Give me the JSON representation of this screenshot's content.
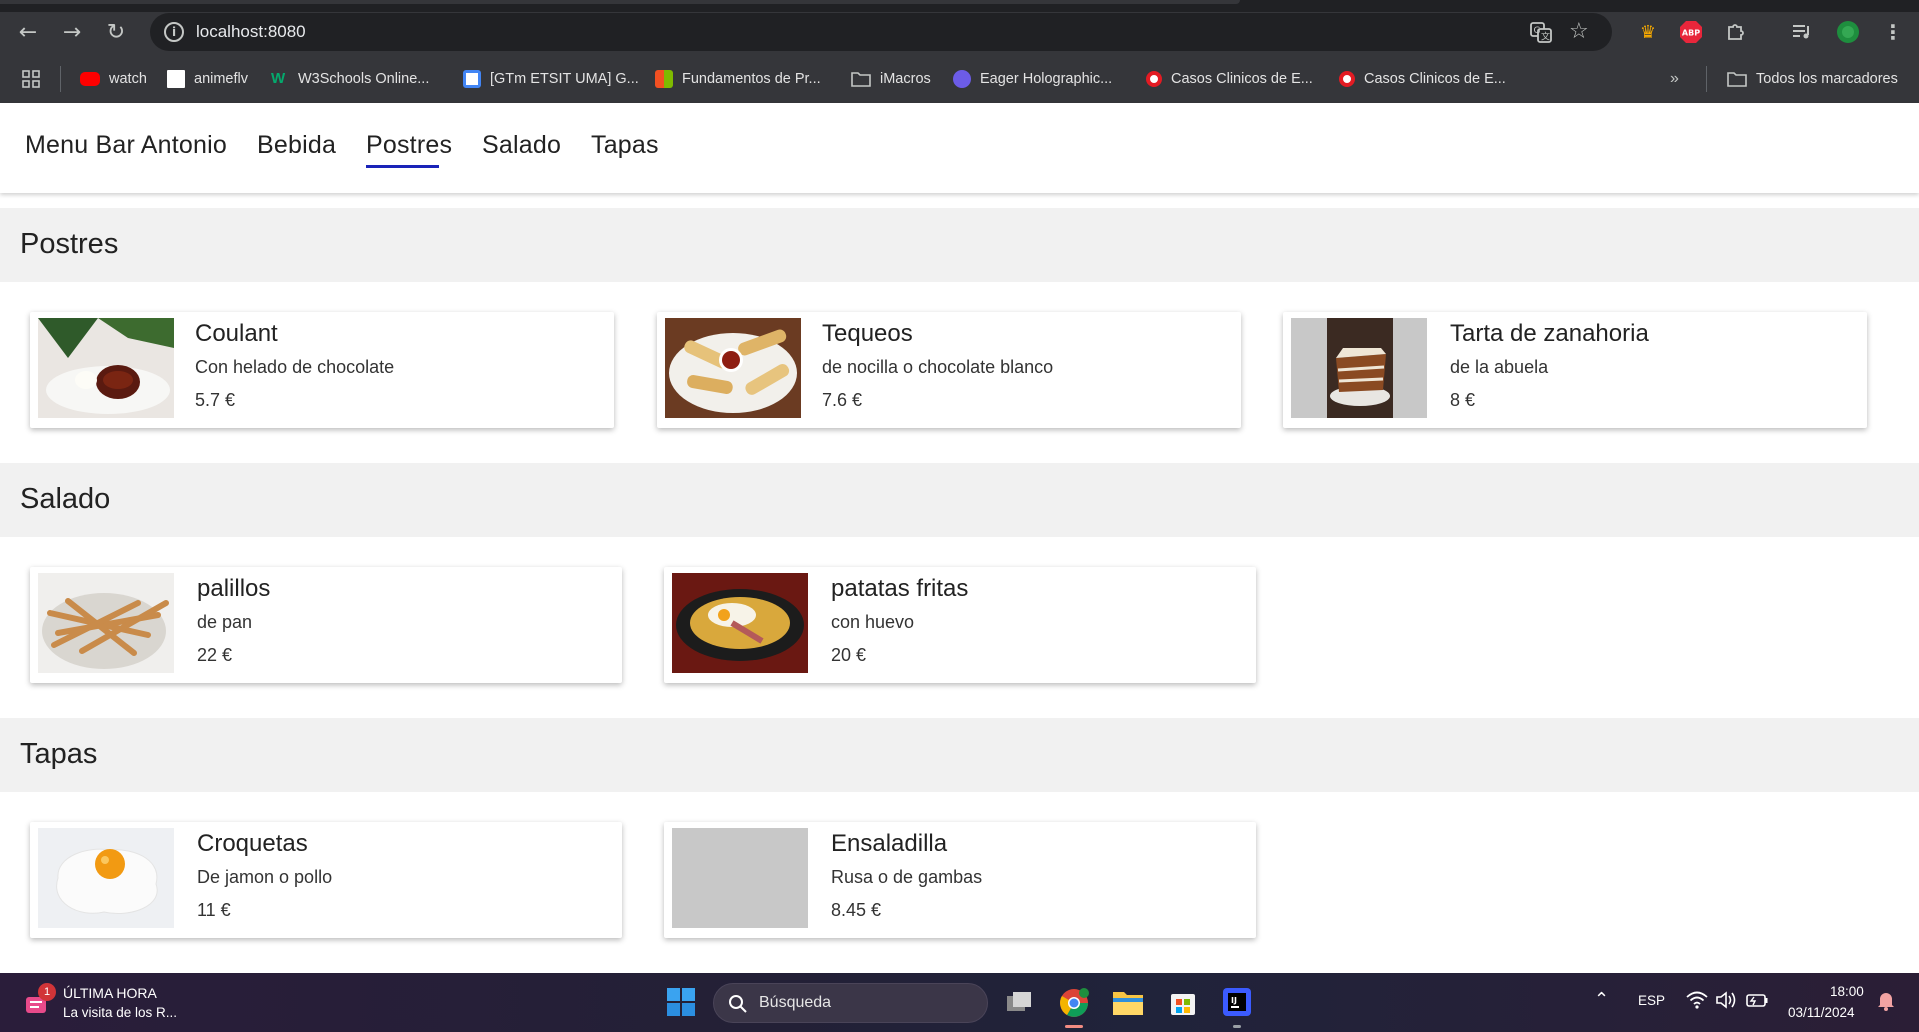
{
  "browser": {
    "url": "localhost:8080",
    "bookmarks": [
      {
        "label": "watch",
        "color": "#ff0000"
      },
      {
        "label": "animeflv",
        "color": "#ffffff"
      },
      {
        "label": "W3Schools Online...",
        "color": "#04aa6d"
      },
      {
        "label": "[GTm ETSIT UMA] G...",
        "color": "#4285f4"
      },
      {
        "label": "Fundamentos de Pr...",
        "color": "#f25022"
      },
      {
        "label": "iMacros",
        "color": "folder"
      },
      {
        "label": "Eager Holographic...",
        "color": "#6c5ce7"
      },
      {
        "label": "Casos Clinicos de E...",
        "color": "#e31b23"
      },
      {
        "label": "Casos Clinicos de E...",
        "color": "#e31b23"
      }
    ],
    "all_bookmarks_label": "Todos los marcadores",
    "extensions": {
      "abp": "ABP"
    }
  },
  "app": {
    "brand": "Menu Bar Antonio",
    "nav": [
      "Bebida",
      "Postres",
      "Salado",
      "Tapas"
    ],
    "active_nav": "Postres",
    "accent": "#1a23b8"
  },
  "sections": [
    {
      "title": "Postres",
      "items": [
        {
          "name": "Coulant",
          "desc": "Con helado de chocolate",
          "price": "5.7 €",
          "image": "coulant-photo"
        },
        {
          "name": "Tequeos",
          "desc": "de nocilla o chocolate blanco",
          "price": "7.6 €",
          "image": "tequeos-photo"
        },
        {
          "name": "Tarta de zanahoria",
          "desc": "de la abuela",
          "price": "8 €",
          "image": "carrot-cake-photo"
        }
      ]
    },
    {
      "title": "Salado",
      "items": [
        {
          "name": "palillos",
          "desc": "de pan",
          "price": "22 €",
          "image": "breadsticks-photo"
        },
        {
          "name": "patatas fritas",
          "desc": "con huevo",
          "price": "20 €",
          "image": "fries-with-egg-photo"
        }
      ]
    },
    {
      "title": "Tapas",
      "items": [
        {
          "name": "Croquetas",
          "desc": "De jamon o pollo",
          "price": "11 €",
          "image": "fried-egg-photo"
        },
        {
          "name": "Ensaladilla",
          "desc": "Rusa o de gambas",
          "price": "8.45 €",
          "image": "placeholder"
        }
      ]
    }
  ],
  "taskbar": {
    "news_badge": "1",
    "news_title": "ÚLTIMA HORA",
    "news_sub": "La visita de los R...",
    "search_placeholder": "Búsqueda",
    "lang": "ESP",
    "time": "18:00",
    "date": "03/11/2024"
  }
}
